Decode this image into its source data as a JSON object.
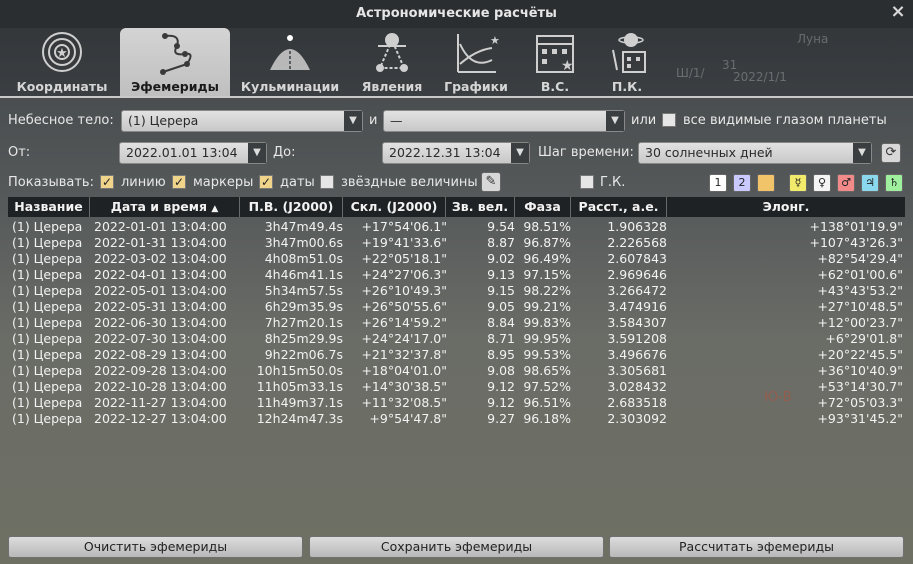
{
  "window": {
    "title": "Астрономические расчёты"
  },
  "sky": {
    "label1": "Луна",
    "label2": "31",
    "label3": "2022/1/1",
    "label4": "Ш/1/",
    "label5": "Ю-В"
  },
  "tabs": [
    {
      "label": "Координаты",
      "icon": "coordinates-icon",
      "active": false
    },
    {
      "label": "Эфемериды",
      "icon": "ephemeris-icon",
      "active": true
    },
    {
      "label": "Кульминации",
      "icon": "culmination-icon",
      "active": false
    },
    {
      "label": "Явления",
      "icon": "phenomena-icon",
      "active": false
    },
    {
      "label": "Графики",
      "icon": "graphs-icon",
      "active": false
    },
    {
      "label": "В.С.",
      "icon": "calendar-icon",
      "active": false
    },
    {
      "label": "П.К.",
      "icon": "planet-calendar-icon",
      "active": false
    }
  ],
  "form": {
    "body_label": "Небесное тело:",
    "body_value": "(1) Церера",
    "and_label": "и",
    "second_body_value": "—",
    "or_label": "или",
    "all_planets_label": "все видимые глазом планеты",
    "from_label": "От:",
    "from_value": "2022.01.01 13:04",
    "to_label": "До:",
    "to_value": "2022.12.31 13:04",
    "step_label": "Шаг времени:",
    "step_value": "30 солнечных дней",
    "show_label": "Показывать:",
    "line_label": "линию",
    "markers_label": "маркеры",
    "dates_label": "даты",
    "magnitudes_label": "звёздные величины",
    "gk_label": "Г.К.",
    "checkmark": "✓"
  },
  "planet_buttons": [
    {
      "glyph": "1",
      "color": "#ffffff"
    },
    {
      "glyph": "2",
      "color": "#c9c9ff"
    },
    {
      "glyph": "",
      "color": "#f2c46a"
    },
    {
      "glyph": "☿",
      "color": "#f2ea6a"
    },
    {
      "glyph": "♀",
      "color": "#f4f4f4"
    },
    {
      "glyph": "♂",
      "color": "#f28a8a"
    },
    {
      "glyph": "♃",
      "color": "#8ad8ee"
    },
    {
      "glyph": "♄",
      "color": "#9ef09e"
    }
  ],
  "table": {
    "headers": [
      "Название",
      "Дата и время",
      "П.В. (J2000)",
      "Скл. (J2000)",
      "Зв. вел.",
      "Фаза",
      "Расст., а.е.",
      "Элонг."
    ],
    "sort_indicator": "▲",
    "rows": [
      [
        "(1) Церера",
        "2022-01-01 13:04:00",
        "3h47m49.4s",
        "+17°54'06.1\"",
        "9.54",
        "98.51%",
        "1.906328",
        "+138°01'19.9\""
      ],
      [
        "(1) Церера",
        "2022-01-31 13:04:00",
        "3h47m00.6s",
        "+19°41'33.6\"",
        "8.87",
        "96.87%",
        "2.226568",
        "+107°43'26.3\""
      ],
      [
        "(1) Церера",
        "2022-03-02 13:04:00",
        "4h08m51.0s",
        "+22°05'18.1\"",
        "9.02",
        "96.49%",
        "2.607843",
        "+82°54'29.4\""
      ],
      [
        "(1) Церера",
        "2022-04-01 13:04:00",
        "4h46m41.1s",
        "+24°27'06.3\"",
        "9.13",
        "97.15%",
        "2.969646",
        "+62°01'00.6\""
      ],
      [
        "(1) Церера",
        "2022-05-01 13:04:00",
        "5h34m57.5s",
        "+26°10'49.3\"",
        "9.15",
        "98.22%",
        "3.266472",
        "+43°43'53.2\""
      ],
      [
        "(1) Церера",
        "2022-05-31 13:04:00",
        "6h29m35.9s",
        "+26°50'55.6\"",
        "9.05",
        "99.21%",
        "3.474916",
        "+27°10'48.5\""
      ],
      [
        "(1) Церера",
        "2022-06-30 13:04:00",
        "7h27m20.1s",
        "+26°14'59.2\"",
        "8.84",
        "99.83%",
        "3.584307",
        "+12°00'23.7\""
      ],
      [
        "(1) Церера",
        "2022-07-30 13:04:00",
        "8h25m29.9s",
        "+24°24'17.0\"",
        "8.71",
        "99.95%",
        "3.591208",
        "+6°29'01.8\""
      ],
      [
        "(1) Церера",
        "2022-08-29 13:04:00",
        "9h22m06.7s",
        "+21°32'37.8\"",
        "8.95",
        "99.53%",
        "3.496676",
        "+20°22'45.5\""
      ],
      [
        "(1) Церера",
        "2022-09-28 13:04:00",
        "10h15m50.0s",
        "+18°04'01.0\"",
        "9.08",
        "98.65%",
        "3.305681",
        "+36°10'40.9\""
      ],
      [
        "(1) Церера",
        "2022-10-28 13:04:00",
        "11h05m33.1s",
        "+14°30'38.5\"",
        "9.12",
        "97.52%",
        "3.028432",
        "+53°14'30.7\""
      ],
      [
        "(1) Церера",
        "2022-11-27 13:04:00",
        "11h49m37.1s",
        "+11°32'08.5\"",
        "9.12",
        "96.51%",
        "2.683518",
        "+72°05'03.3\""
      ],
      [
        "(1) Церера",
        "2022-12-27 13:04:00",
        "12h24m47.3s",
        "+9°54'47.8\"",
        "9.27",
        "96.18%",
        "2.303092",
        "+93°31'45.2\""
      ]
    ]
  },
  "buttons": {
    "clear": "Очистить эфемериды",
    "save": "Сохранить эфемериды",
    "compute": "Рассчитать эфемериды"
  },
  "icons": {
    "close": "×",
    "dropdown": "▼",
    "pen": "✎",
    "reset": "⟳"
  }
}
